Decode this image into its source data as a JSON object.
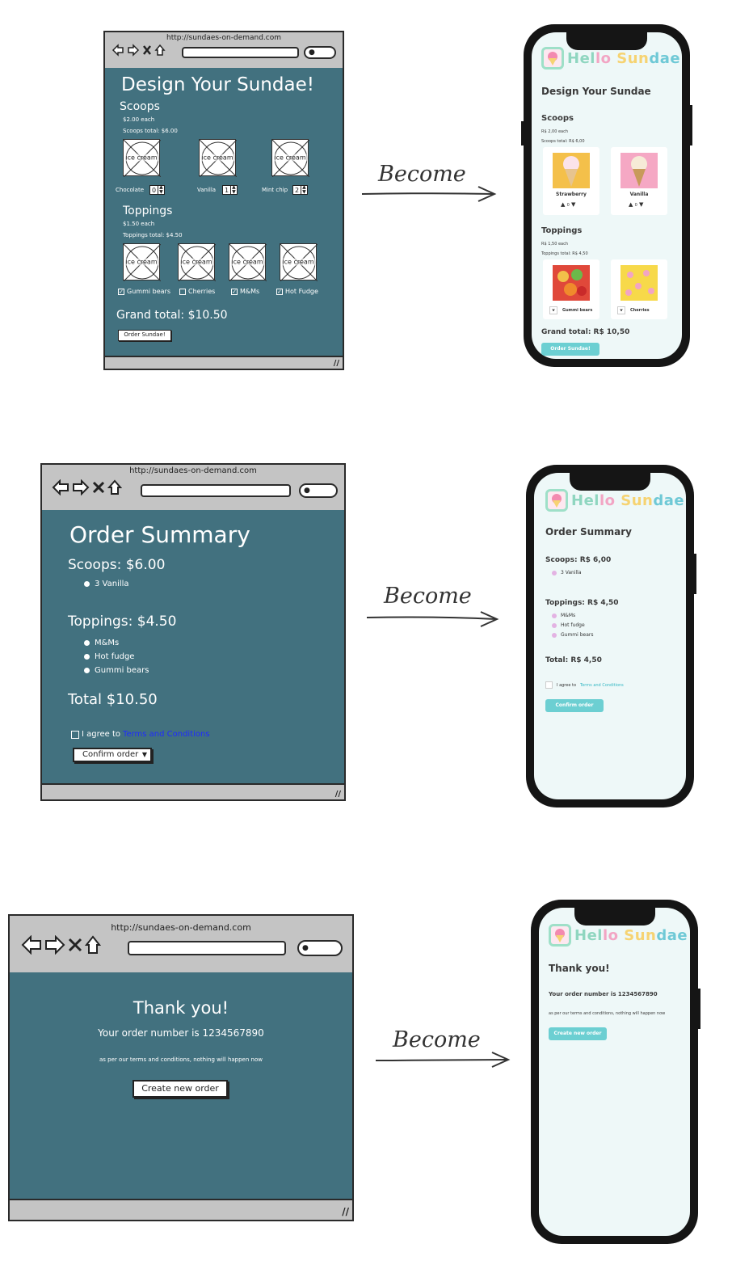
{
  "url": "http://sundaes-on-demand.com",
  "become_label": "Become",
  "brand": {
    "name": "Hello Sundae",
    "colors": [
      "#8fd6c0",
      "#f2a5c4",
      "#f6d372",
      "#6fc9d6"
    ]
  },
  "colors": {
    "wire_bg": "#42717f",
    "phone_bg": "#eef8f8",
    "accent": "#6ccfd2",
    "bullet": "#e3b3e3"
  },
  "panel1": {
    "wire": {
      "title": "Design Your Sundae!",
      "scoops_heading": "Scoops",
      "scoops_price": "$2.00 each",
      "scoops_total": "Scoops total: $6.00",
      "image_placeholder": "ice cream",
      "flavors": [
        {
          "name": "Chocolate",
          "qty": "0"
        },
        {
          "name": "Vanilla",
          "qty": "1"
        },
        {
          "name": "Mint chip",
          "qty": "2"
        }
      ],
      "toppings_heading": "Toppings",
      "toppings_price": "$1.50 each",
      "toppings_total": "Toppings total: $4.50",
      "toppings": [
        {
          "name": "Gummi bears",
          "checked": true
        },
        {
          "name": "Cherries",
          "checked": false
        },
        {
          "name": "M&Ms",
          "checked": true
        },
        {
          "name": "Hot Fudge",
          "checked": true
        }
      ],
      "grand_total": "Grand total: $10.50",
      "order_button": "Order Sundae!"
    },
    "phone": {
      "title": "Design Your Sundae",
      "scoops_heading": "Scoops",
      "scoops_price": "R$ 2,00 each",
      "scoops_total": "Scoops total: R$ 6,00",
      "scoop_cards": [
        {
          "name": "Strawberry",
          "qty": "0"
        },
        {
          "name": "Vanilla",
          "qty": "0"
        }
      ],
      "toppings_heading": "Toppings",
      "toppings_price": "R$ 1,50 each",
      "toppings_total": "Toppings total: R$ 4,50",
      "topping_cards": [
        {
          "name": "Gummi bears",
          "check": "v"
        },
        {
          "name": "Cherries",
          "check": "v"
        }
      ],
      "grand_total": "Grand total: R$ 10,50",
      "order_button": "Order Sundae!"
    }
  },
  "panel2": {
    "wire": {
      "title": "Order Summary",
      "scoops": "Scoops: $6.00",
      "scoop_items": [
        "3 Vanilla"
      ],
      "toppings": "Toppings: $4.50",
      "topping_items": [
        "M&Ms",
        "Hot fudge",
        "Gummi bears"
      ],
      "total": "Total $10.50",
      "agree_text": "I agree to",
      "terms_link": "Terms and Conditions",
      "confirm_button": "Confirm order"
    },
    "phone": {
      "title": "Order Summary",
      "scoops": "Scoops: R$ 6,00",
      "scoop_items": [
        "3 Vanilla"
      ],
      "toppings": "Toppings: R$ 4,50",
      "topping_items": [
        "M&Ms",
        "Hot fudge",
        "Gummi bears"
      ],
      "total": "Total: R$ 4,50",
      "agree_text": "I agree to",
      "terms_link": "Terms and Conditions",
      "confirm_button": "Confirm order"
    }
  },
  "panel3": {
    "wire": {
      "title": "Thank you!",
      "order_number": "Your order number is 1234567890",
      "note": "as per our terms and conditions, nothing will happen now",
      "new_order_button": "Create new order"
    },
    "phone": {
      "title": "Thank you!",
      "order_number": "Your order number is 1234567890",
      "note": "as per our terms and conditions, nothing will happen now",
      "new_order_button": "Create new order"
    }
  }
}
